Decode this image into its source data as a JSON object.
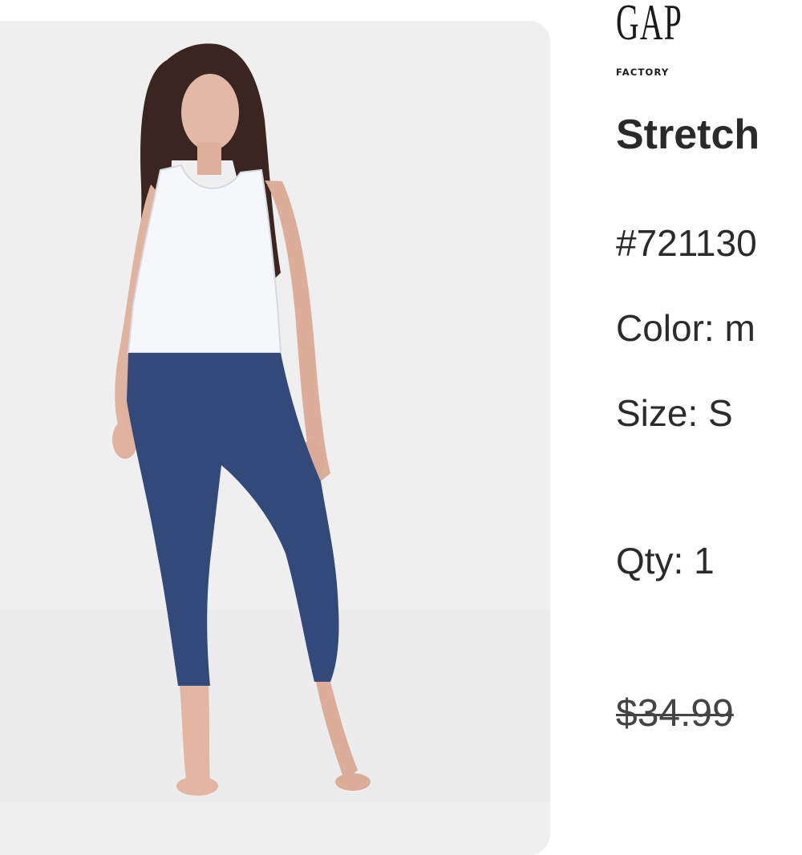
{
  "brand": {
    "name": "GAP",
    "sub": "FACTORY"
  },
  "product": {
    "title": "Stretch",
    "sku": "#721130",
    "color": "Color: m",
    "size": "Size: S",
    "qty": "Qty: 1",
    "original_price": "$34.99"
  },
  "image": {
    "alt": "Model wearing navy capri leggings and white tank top",
    "icon": "product-photo"
  }
}
